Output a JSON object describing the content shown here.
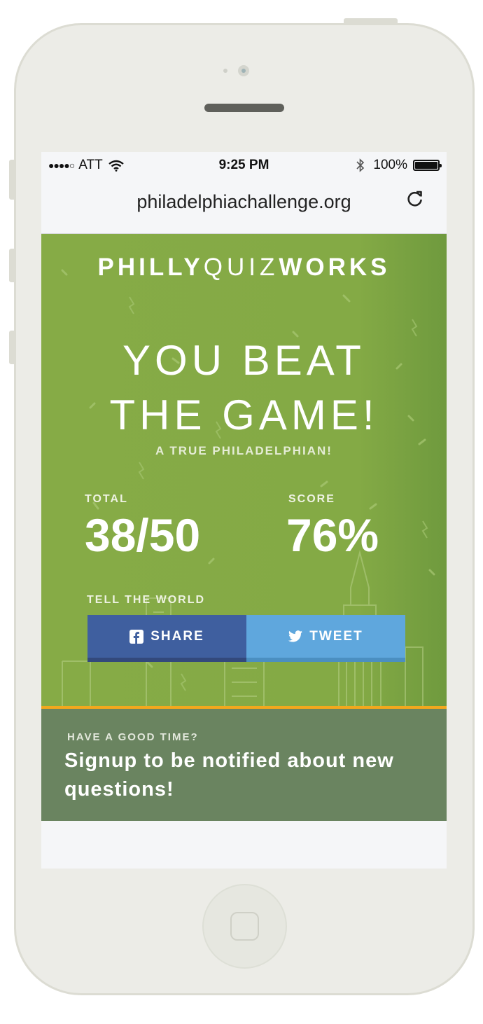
{
  "status_bar": {
    "signal": "●●●●○",
    "carrier": "ATT",
    "time": "9:25 PM",
    "battery_percent": "100%",
    "battery_level": 1.0
  },
  "browser": {
    "url": "philadelphiachallenge.org",
    "reload_icon": "reload-icon"
  },
  "quiz": {
    "logo_philly": "PHILLY",
    "logo_quiz": "QUIZ",
    "logo_works": "WORKS",
    "headline_line1": "YOU BEAT",
    "headline_line2": "THE GAME!",
    "subtitle": "A TRUE PHILADELPHIAN!",
    "total_label": "TOTAL",
    "total_value": "38/50",
    "score_label": "SCORE",
    "score_value": "76%",
    "tell_label": "TELL THE WORLD",
    "share_label": "SHARE",
    "tweet_label": "TWEET"
  },
  "signup": {
    "kicker": "HAVE A GOOD TIME?",
    "text": "Signup to be notified about new questions!"
  },
  "colors": {
    "green": "#86ab46",
    "facebook": "#3f5f9f",
    "twitter": "#5fa7dd",
    "accent_line": "#f2a81d",
    "signup_bg": "#6a8460"
  }
}
